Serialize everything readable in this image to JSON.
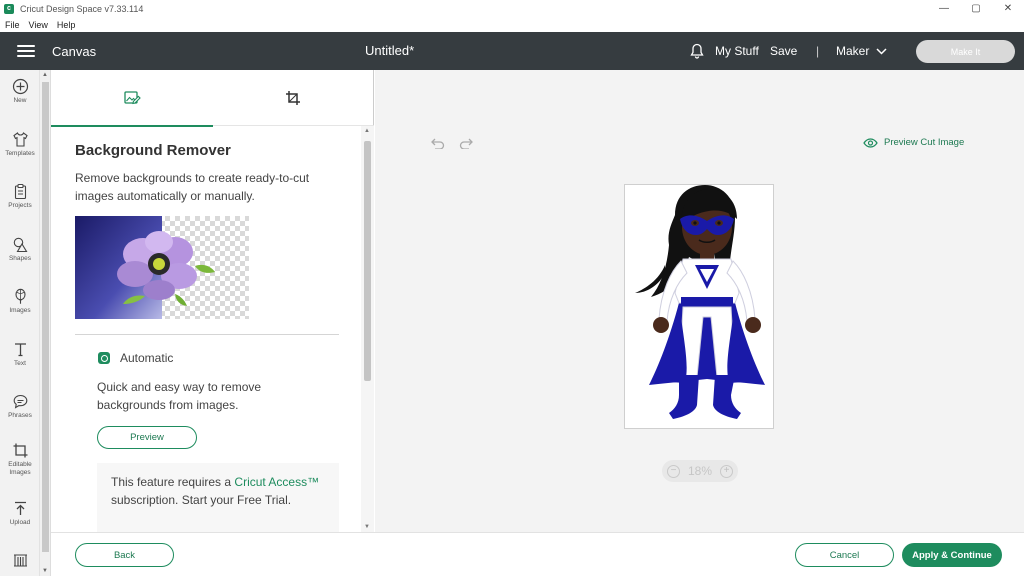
{
  "window": {
    "title": "Cricut Design Space  v7.33.114",
    "controls": {
      "minimize": "—",
      "maximize": "▢",
      "close": "✕"
    }
  },
  "menu": {
    "items": [
      "File",
      "View",
      "Help"
    ]
  },
  "header": {
    "canvas_label": "Canvas",
    "document_title": "Untitled*",
    "my_stuff": "My Stuff",
    "save": "Save",
    "separator": "|",
    "machine": "Maker",
    "make_it": "Make It"
  },
  "toolbar": {
    "items": [
      {
        "label": "New",
        "icon": "plus-circle-icon"
      },
      {
        "label": "Templates",
        "icon": "shirt-icon"
      },
      {
        "label": "Projects",
        "icon": "clipboard-icon"
      },
      {
        "label": "Shapes",
        "icon": "shapes-icon"
      },
      {
        "label": "Images",
        "icon": "balloon-icon"
      },
      {
        "label": "Text",
        "icon": "text-icon"
      },
      {
        "label": "Phrases",
        "icon": "speech-bubble-icon"
      },
      {
        "label": "Editable Images",
        "icon": "crop-edit-icon"
      },
      {
        "label": "Upload",
        "icon": "upload-icon"
      }
    ]
  },
  "panel": {
    "tabs": [
      {
        "name": "background-remover-tab",
        "icon": "image-edit-icon",
        "active": true
      },
      {
        "name": "crop-tab",
        "icon": "crop-icon",
        "active": false
      }
    ],
    "title": "Background Remover",
    "description": "Remove backgrounds to create ready-to-cut images automatically or manually.",
    "automatic": {
      "label": "Automatic",
      "description": "Quick and easy way to remove backgrounds from images.",
      "preview_button": "Preview"
    },
    "access_note": {
      "prefix": "This feature requires a ",
      "link": "Cricut Access™",
      "suffix": " subscription. Start your Free Trial."
    }
  },
  "canvas": {
    "preview_cut": "Preview Cut Image",
    "zoom_value": "18%",
    "zoom_out": "−",
    "zoom_in": "+"
  },
  "footer": {
    "back": "Back",
    "cancel": "Cancel",
    "apply": "Apply & Continue"
  },
  "colors": {
    "accent": "#1e8c5e",
    "header_bg": "#363c40",
    "hero_suit_blue": "#1a1aa8"
  }
}
